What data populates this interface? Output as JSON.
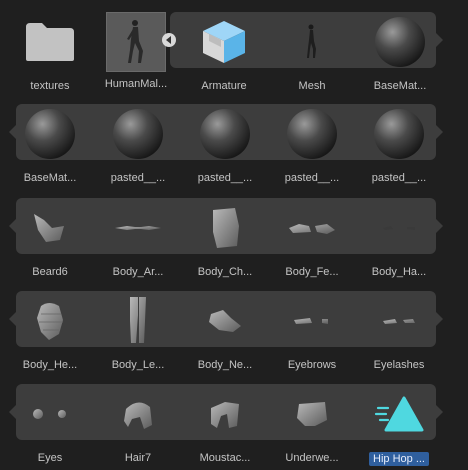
{
  "row1": {
    "items": [
      {
        "label": "textures",
        "icon": "folder-icon"
      },
      {
        "label": "HumanMal...",
        "icon": "human-model-icon"
      },
      {
        "label": "Armature",
        "icon": "armature-icon"
      },
      {
        "label": "Mesh",
        "icon": "mesh-icon"
      },
      {
        "label": "BaseMat...",
        "icon": "material-sphere-icon"
      }
    ]
  },
  "row2": {
    "items": [
      {
        "label": "BaseMat...",
        "icon": "material-sphere-icon"
      },
      {
        "label": "pasted__...",
        "icon": "material-sphere-icon"
      },
      {
        "label": "pasted__...",
        "icon": "material-sphere-icon"
      },
      {
        "label": "pasted__...",
        "icon": "material-sphere-icon"
      },
      {
        "label": "pasted__...",
        "icon": "material-sphere-icon"
      }
    ]
  },
  "row3": {
    "items": [
      {
        "label": "Beard6",
        "icon": "mesh-beard-icon"
      },
      {
        "label": "Body_Ar...",
        "icon": "mesh-arms-icon"
      },
      {
        "label": "Body_Ch...",
        "icon": "mesh-chest-icon"
      },
      {
        "label": "Body_Fe...",
        "icon": "mesh-feet-icon"
      },
      {
        "label": "Body_Ha...",
        "icon": "mesh-hands-icon"
      }
    ]
  },
  "row4": {
    "items": [
      {
        "label": "Body_He...",
        "icon": "mesh-head-icon"
      },
      {
        "label": "Body_Le...",
        "icon": "mesh-legs-icon"
      },
      {
        "label": "Body_Ne...",
        "icon": "mesh-neck-icon"
      },
      {
        "label": "Eyebrows",
        "icon": "mesh-eyebrows-icon"
      },
      {
        "label": "Eyelashes",
        "icon": "mesh-eyelashes-icon"
      }
    ]
  },
  "row5": {
    "items": [
      {
        "label": "Eyes",
        "icon": "mesh-eyes-icon"
      },
      {
        "label": "Hair7",
        "icon": "mesh-hair-icon"
      },
      {
        "label": "Moustac...",
        "icon": "mesh-moustache-icon"
      },
      {
        "label": "Underwe...",
        "icon": "mesh-underwear-icon"
      },
      {
        "label": "Hip Hop ...",
        "icon": "animation-clip-icon"
      }
    ]
  },
  "colors": {
    "background": "#1f1f1f",
    "strip": "#3d3d3d",
    "selection": "#2f5f9e",
    "accent_cyan": "#4fd8e0",
    "armature_blue": "#5ab4e8"
  }
}
